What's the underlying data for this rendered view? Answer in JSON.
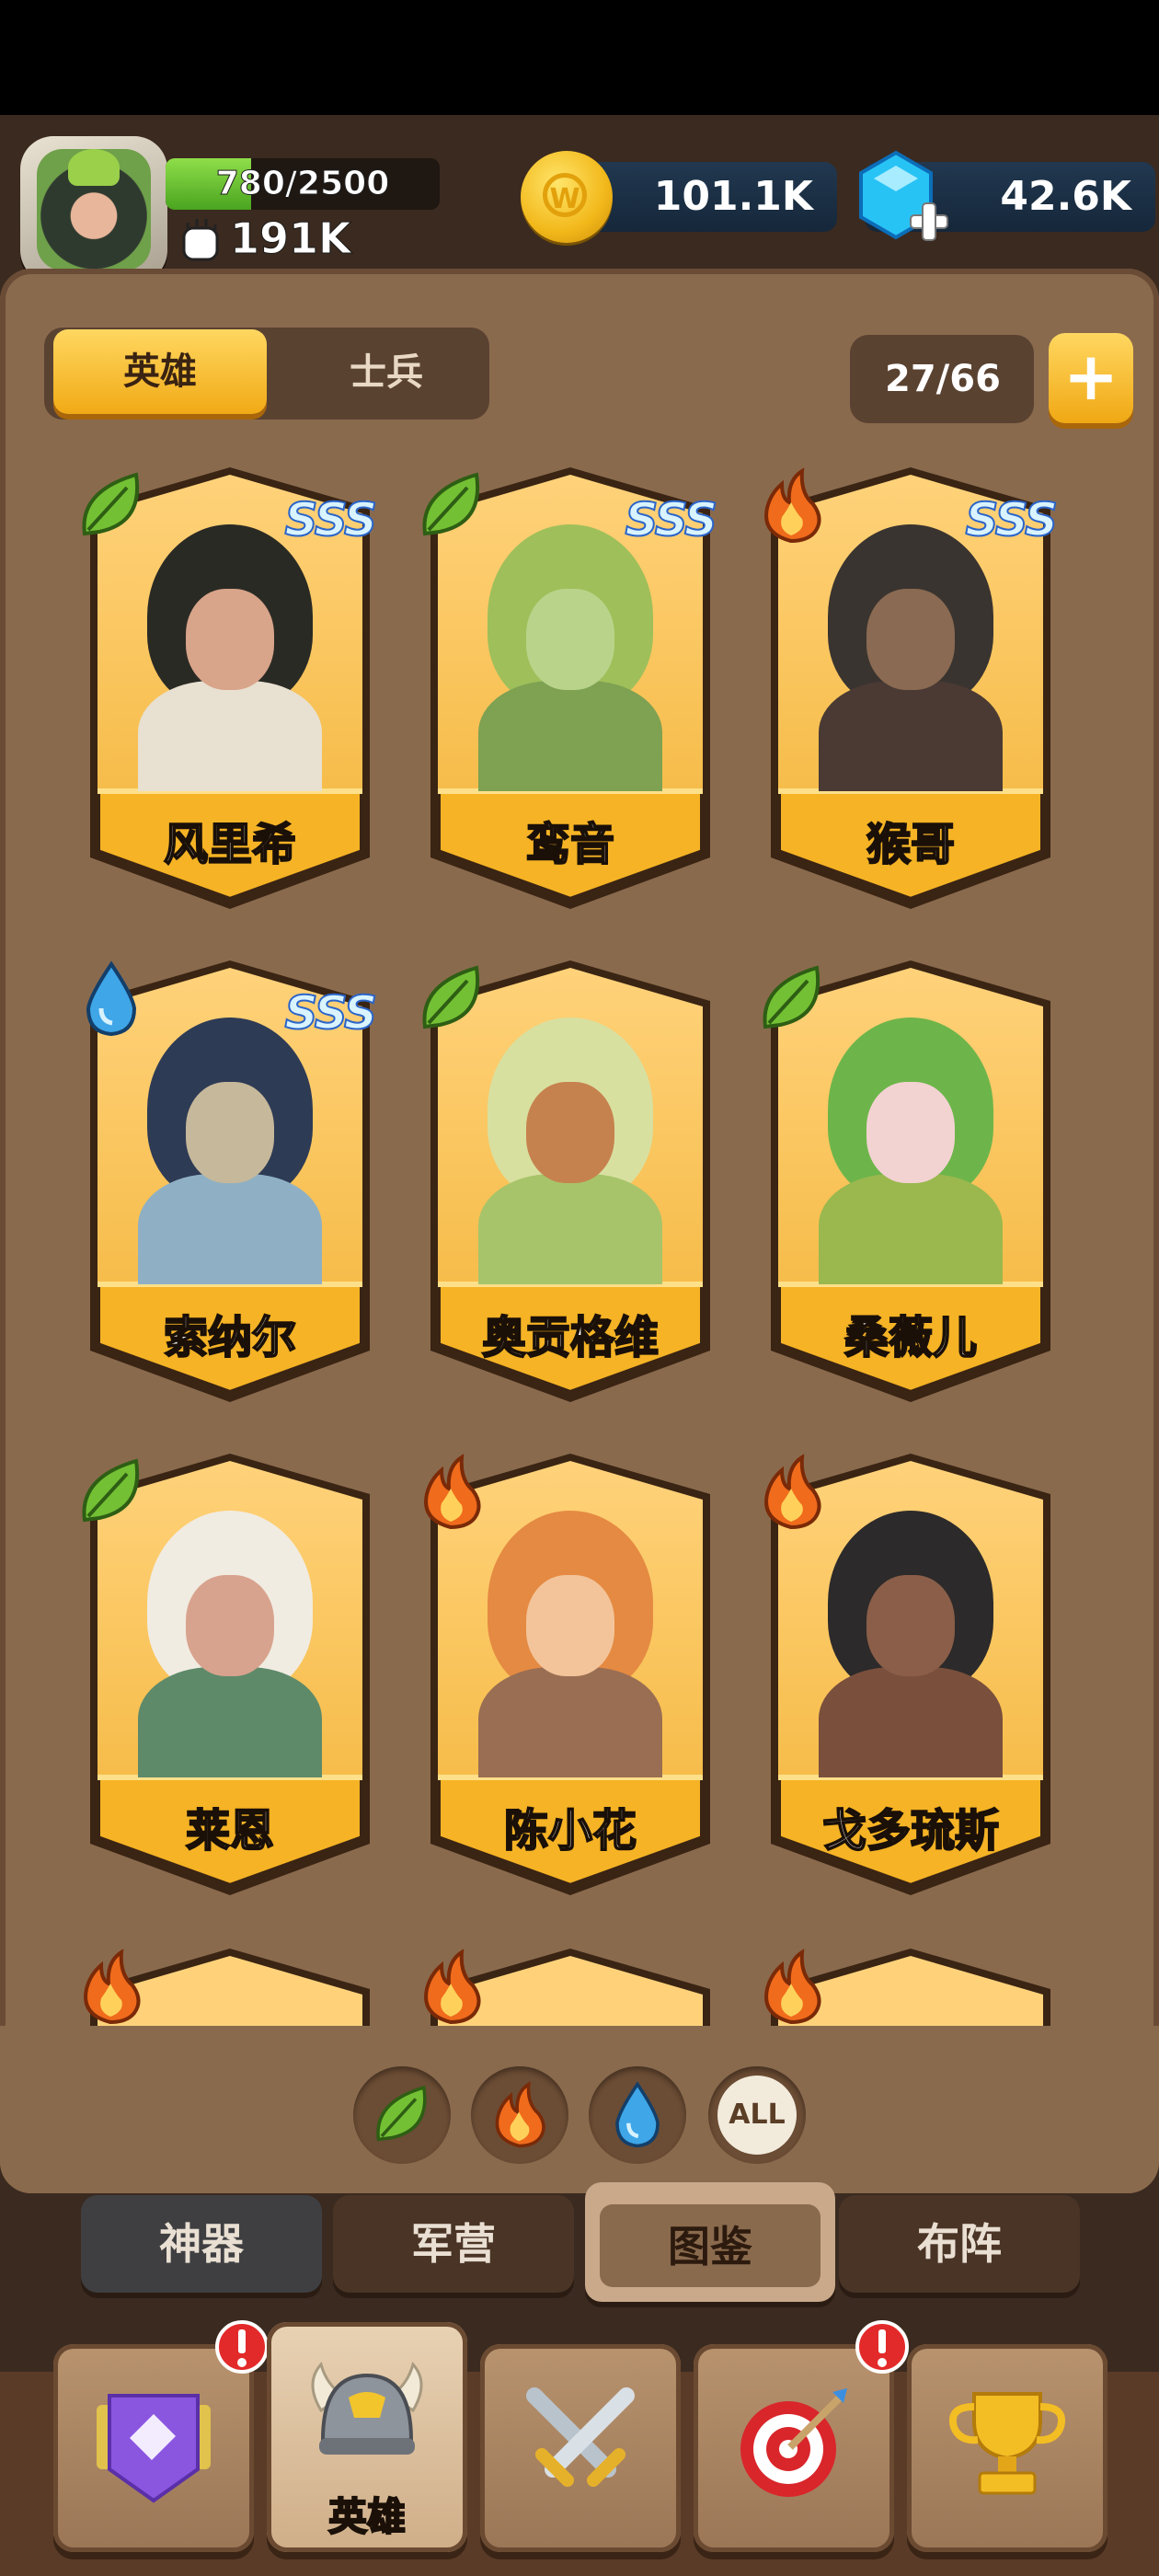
{
  "player": {
    "xp_text": "780/2500",
    "xp_progress": 0.312,
    "power": "191K"
  },
  "resources": {
    "gold": "101.1K",
    "gems": "42.6K"
  },
  "tabs": {
    "hero": "英雄",
    "soldier": "士兵"
  },
  "collection_count": "27/66",
  "heroes": [
    {
      "name": "风里希",
      "element": "leaf",
      "rank": "SSS",
      "palette": [
        "#2a2a24",
        "#d8a48a",
        "#e8e0d0"
      ]
    },
    {
      "name": "鸾音",
      "element": "leaf",
      "rank": "SSS",
      "palette": [
        "#9fbf5a",
        "#b9d48a",
        "#7ea152"
      ]
    },
    {
      "name": "猴哥",
      "element": "fire",
      "rank": "SSS",
      "palette": [
        "#3a3430",
        "#8a6a52",
        "#4a3a33"
      ]
    },
    {
      "name": "索纳尔",
      "element": "water",
      "rank": "SSS",
      "palette": [
        "#2e3b55",
        "#c6b89a",
        "#8fb0c4"
      ]
    },
    {
      "name": "奥贡格维",
      "element": "leaf",
      "rank": "",
      "palette": [
        "#d8e0a0",
        "#c6824e",
        "#a7c46a"
      ]
    },
    {
      "name": "桑薇儿",
      "element": "leaf",
      "rank": "",
      "palette": [
        "#6db54a",
        "#f3d2d2",
        "#9ab84e"
      ]
    },
    {
      "name": "莱恩",
      "element": "leaf",
      "rank": "",
      "palette": [
        "#f1ece2",
        "#d8a38e",
        "#5e8a6a"
      ]
    },
    {
      "name": "陈小花",
      "element": "fire",
      "rank": "",
      "palette": [
        "#e58a42",
        "#f3c49a",
        "#9a6e52"
      ]
    },
    {
      "name": "戈多琉斯",
      "element": "fire",
      "rank": "",
      "palette": [
        "#2c2a2a",
        "#8a5e48",
        "#7a4f3c"
      ]
    }
  ],
  "peek_elements": [
    "fire",
    "fire",
    "fire"
  ],
  "filters": [
    "leaf",
    "fire",
    "water",
    "ALL"
  ],
  "filter_all_label": "ALL",
  "subtabs": {
    "artifact": "神器",
    "barracks": "军营",
    "codex": "图鉴",
    "formation": "布阵"
  },
  "nav": {
    "hero_label": "英雄"
  },
  "colors": {
    "panel": "#8a6a4d",
    "card_gold": "#f5b325",
    "leaf": "#74c034",
    "fire": "#f06b1c",
    "water": "#3fa6e8"
  }
}
